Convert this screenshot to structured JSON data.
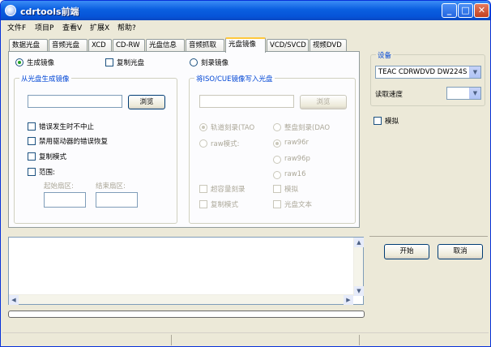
{
  "window": {
    "title": "cdrtools前端",
    "controls": {
      "minimize": "_",
      "maximize": "□",
      "close": "✕"
    }
  },
  "menu": [
    "文件F",
    "项目P",
    "查看V",
    "扩展X",
    "帮助?"
  ],
  "tabs": [
    "数据光盘",
    "音频光盘",
    "XCD",
    "CD-RW",
    "光盘信息",
    "音频抓取",
    "光盘镜像",
    "VCD/SVCD",
    "视频DVD"
  ],
  "active_tab_index": 6,
  "image_tab": {
    "mode_generate": "生成镜像",
    "mode_copy": "复制光盘",
    "mode_burn": "刻录镜像",
    "create_group": {
      "title": "从光盘生成镜像",
      "path_value": "",
      "browse_label": "浏览",
      "options": [
        "错误发生时不中止",
        "禁用驱动器的错误恢复",
        "复制模式",
        "范围:"
      ],
      "start_sector_label": "起始扇区:",
      "end_sector_label": "结束扇区:"
    },
    "write_group": {
      "title": "将ISO/CUE镜像写入光盘",
      "path_value": "",
      "browse_label": "浏览",
      "track_at_once": "轨道刻录(TAO",
      "disc_at_once": "整盘刻录(DAO",
      "raw_mode": "raw模式:",
      "raw96r": "raw96r",
      "raw96p": "raw96p",
      "raw16": "raw16",
      "overburn": "超容量刻录",
      "simulate": "模拟",
      "copy_mode": "复制模式",
      "cd_text": "光盘文本"
    }
  },
  "device": {
    "group_title": "设备",
    "drive": "TEAC CDRWDVD DW224S",
    "speed_label": "读取速度",
    "speed_value": "",
    "simulate_label": "模拟"
  },
  "actions": {
    "start": "开始",
    "cancel": "取消"
  },
  "log": {
    "text": ""
  },
  "progress": {
    "value": 0.0
  }
}
